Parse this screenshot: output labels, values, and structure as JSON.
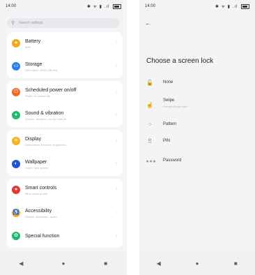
{
  "left_screen": {
    "status": {
      "time": "14:00",
      "icons": "✱ ᯤ ▮ .ıl"
    },
    "search": {
      "placeholder": "Search settings"
    },
    "items": [
      {
        "title": "Battery",
        "subtitle": "89%",
        "icon": "battery-icon",
        "color": "#f5a623",
        "glyph": "●"
      },
      {
        "title": "Storage",
        "subtitle": "29% used - 46.92 GB free",
        "icon": "storage-icon",
        "color": "#2b7de9",
        "glyph": "▭"
      },
      {
        "title": "Scheduled power on/off",
        "subtitle": "Power on, power off",
        "icon": "power-icon",
        "color": "#f06a24",
        "glyph": "⏻"
      },
      {
        "title": "Sound & vibration",
        "subtitle": "Volume, vibration, Do Not Disturb",
        "icon": "sound-icon",
        "color": "#1fba6a",
        "glyph": "●"
      },
      {
        "title": "Display",
        "subtitle": "Dark theme, font size, brightness",
        "icon": "display-icon",
        "color": "#f5b324",
        "glyph": "☀"
      },
      {
        "title": "Wallpaper",
        "subtitle": "Home, lock screen",
        "icon": "wallpaper-icon",
        "color": "#2155d6",
        "glyph": "◐"
      },
      {
        "title": "Smart controls",
        "subtitle": "lift to check phone",
        "icon": "smart-controls-icon",
        "color": "#e53935",
        "glyph": "●"
      },
      {
        "title": "Accessibility",
        "subtitle": "Display, interaction, audio",
        "icon": "accessibility-icon",
        "color": "#f5a623",
        "glyph": "♿"
      },
      {
        "title": "Special function",
        "subtitle": "",
        "icon": "special-function-icon",
        "color": "#1fba6a",
        "glyph": "✿"
      }
    ],
    "nav": {
      "back": "◀",
      "home": "●",
      "recents": "■"
    }
  },
  "right_screen": {
    "status": {
      "time": "14:00",
      "icons": "✱ ᯤ ▮ .ıl"
    },
    "back": "←",
    "title": "Choose a screen lock",
    "options": [
      {
        "title": "None",
        "subtitle": "",
        "icon": "unlock-icon",
        "glyph": "🔓"
      },
      {
        "title": "Swipe",
        "subtitle": "Current screen lock",
        "icon": "swipe-icon",
        "glyph": "☝"
      },
      {
        "title": "Pattern",
        "subtitle": "",
        "icon": "pattern-icon",
        "glyph": "⁘"
      },
      {
        "title": "PIN",
        "subtitle": "",
        "icon": "pin-icon",
        "glyph": "⠿"
      },
      {
        "title": "Password",
        "subtitle": "",
        "icon": "password-icon",
        "glyph": "∗∗∗"
      }
    ],
    "nav": {
      "back": "◀",
      "home": "●",
      "recents": "■"
    }
  }
}
